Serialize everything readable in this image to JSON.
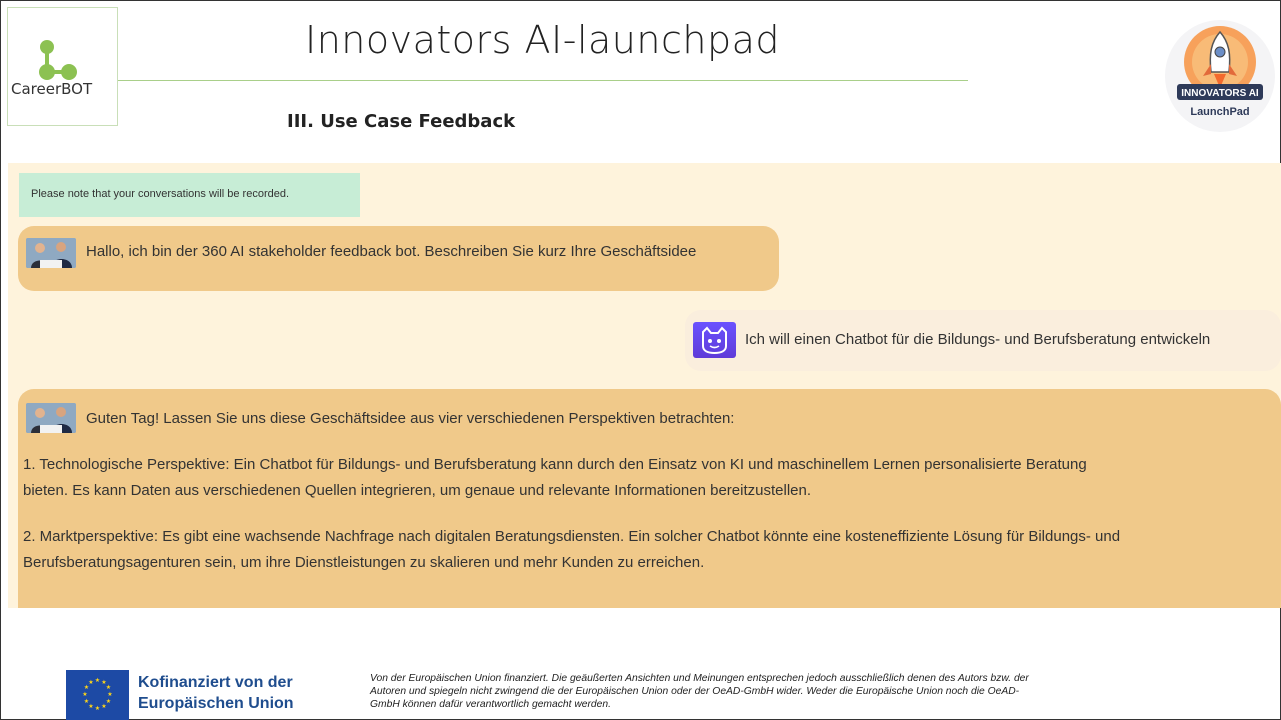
{
  "header": {
    "logo_text": "CareerBOT",
    "title": "Innovators AI-launchpad",
    "section": "III. Use Case Feedback",
    "badge_line1": "INNOVATORS AI",
    "badge_line2": "LaunchPad"
  },
  "chat": {
    "notice": "Please note that your conversations will be recorded.",
    "bot_greeting": "Hallo, ich bin der 360 AI stakeholder feedback bot. Beschreiben Sie kurz Ihre Geschäftsidee",
    "user_message": "Ich will einen Chatbot für die Bildungs- und Berufsberatung entwickeln",
    "bot_reply": {
      "intro": "Guten Tag! Lassen Sie uns diese Geschäftsidee aus vier verschiedenen Perspektiven betrachten:",
      "point1_line1": "1. Technologische Perspektive: Ein Chatbot für Bildungs- und Berufsberatung kann durch den Einsatz von KI und maschinellem Lernen personalisierte Beratung",
      "point1_line2": "bieten. Es kann Daten aus verschiedenen Quellen integrieren, um genaue und relevante Informationen bereitzustellen.",
      "point2_line1": "2. Marktperspektive: Es gibt eine wachsende Nachfrage nach digitalen Beratungsdiensten. Ein solcher Chatbot könnte eine kosteneffiziente Lösung für Bildungs- und",
      "point2_line2": "Berufsberatungsagenturen sein, um ihre Dienstleistungen zu skalieren und mehr Kunden zu erreichen."
    }
  },
  "footer": {
    "eu_line1": "Kofinanziert von der",
    "eu_line2": "Europäischen Union",
    "disclaimer_line1": "Von der Europäischen Union finanziert. Die geäußerten Ansichten und Meinungen entsprechen jedoch ausschließlich denen des Autors bzw. der",
    "disclaimer_line2": "Autoren und spiegeln nicht zwingend die der Europäischen Union oder der OeAD-GmbH wider. Weder die Europäische Union noch die OeAD-",
    "disclaimer_line3": "GmbH können dafür verantwortlich gemacht werden."
  },
  "colors": {
    "bot_bubble": "#f0c98a",
    "user_bubble": "#faeedd",
    "chat_background": "#fef3dc",
    "notice_background": "#c7edd6",
    "accent_green": "#8cc152",
    "eu_blue": "#1d4aa5"
  },
  "icons": {
    "logo": "careerbot-molecule-icon",
    "badge": "rocket-badge-icon",
    "bot_avatar": "business-people-photo",
    "user_avatar": "cat-mascot-icon",
    "eu": "eu-flag-icon"
  }
}
